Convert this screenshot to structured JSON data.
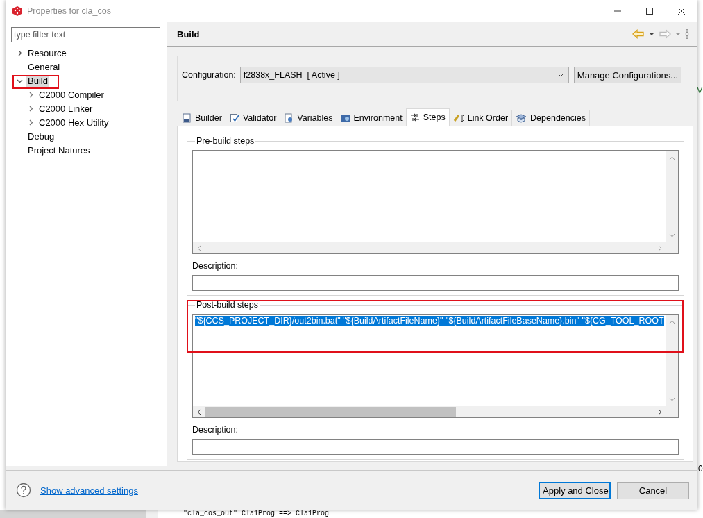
{
  "window": {
    "title": "Properties for cla_cos"
  },
  "filter": {
    "placeholder": "type filter text"
  },
  "tree": [
    {
      "label": "Resource",
      "kind": "node",
      "expanded": false,
      "selected": false
    },
    {
      "label": "General",
      "kind": "leaf",
      "selected": false
    },
    {
      "label": "Build",
      "kind": "node",
      "expanded": true,
      "selected": true,
      "children": [
        {
          "label": "C2000 Compiler",
          "kind": "node",
          "expanded": false,
          "selected": false
        },
        {
          "label": "C2000 Linker",
          "kind": "node",
          "expanded": false,
          "selected": false
        },
        {
          "label": "C2000 Hex Utility",
          "kind": "node",
          "expanded": false,
          "selected": false
        }
      ]
    },
    {
      "label": "Debug",
      "kind": "leaf",
      "selected": false
    },
    {
      "label": "Project Natures",
      "kind": "leaf",
      "selected": false
    }
  ],
  "page": {
    "title": "Build"
  },
  "configuration": {
    "label": "Configuration:",
    "value": "f2838x_FLASH  [ Active ]",
    "manage_button": "Manage Configurations..."
  },
  "tabs": [
    {
      "label": "Builder",
      "kind": "builder",
      "selected": false
    },
    {
      "label": "Validator",
      "kind": "validator",
      "selected": false
    },
    {
      "label": "Variables",
      "kind": "variables",
      "selected": false
    },
    {
      "label": "Environment",
      "kind": "environment",
      "selected": false
    },
    {
      "label": "Steps",
      "kind": "steps",
      "selected": true
    },
    {
      "label": "Link Order",
      "kind": "link",
      "selected": false
    },
    {
      "label": "Dependencies",
      "kind": "dependencies",
      "selected": false
    }
  ],
  "pre_build": {
    "legend": "Pre-build steps",
    "description_label": "Description:"
  },
  "post_build": {
    "legend": "Post-build steps",
    "command": "\"${CCS_PROJECT_DIR}/out2bin.bat\" \"${BuildArtifactFileName}\" \"${BuildArtifactFileBaseName}.bin\" \"${CG_TOOL_ROOT",
    "description_label": "Description:"
  },
  "footer": {
    "link": "Show advanced settings",
    "buttons": [
      {
        "label": "Apply and Close",
        "kind": "default"
      },
      {
        "label": "Cancel",
        "kind": "normal"
      }
    ]
  },
  "background": {
    "editor_line": "\"cla_cos_out\" Cla1Prog ==> Cla1Prog",
    "side_text_1": "V",
    "side_text_2": "0"
  }
}
